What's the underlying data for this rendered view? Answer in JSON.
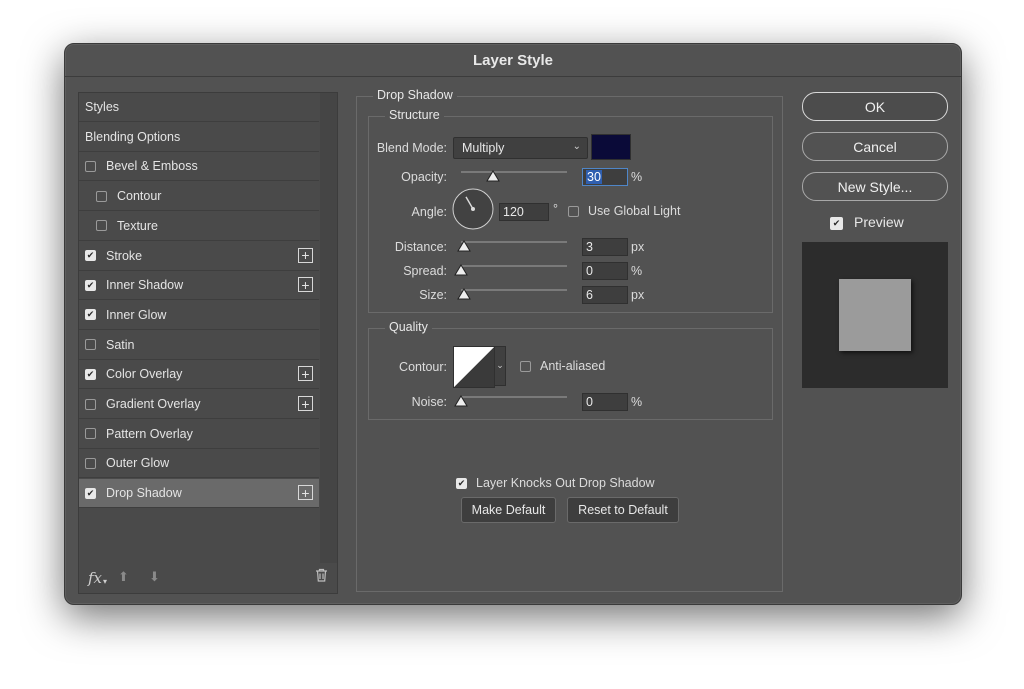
{
  "dialog": {
    "title": "Layer Style"
  },
  "style_list": {
    "items": [
      {
        "label": "Styles",
        "kind": "header"
      },
      {
        "label": "Blending Options",
        "kind": "header"
      },
      {
        "label": "Bevel & Emboss",
        "checked": false
      },
      {
        "label": "Contour",
        "checked": false,
        "indent": true
      },
      {
        "label": "Texture",
        "checked": false,
        "indent": true
      },
      {
        "label": "Stroke",
        "checked": true,
        "plus": true
      },
      {
        "label": "Inner Shadow",
        "checked": true,
        "plus": true
      },
      {
        "label": "Inner Glow",
        "checked": true
      },
      {
        "label": "Satin",
        "checked": false
      },
      {
        "label": "Color Overlay",
        "checked": true,
        "plus": true
      },
      {
        "label": "Gradient Overlay",
        "checked": false,
        "plus": true
      },
      {
        "label": "Pattern Overlay",
        "checked": false
      },
      {
        "label": "Outer Glow",
        "checked": false
      },
      {
        "label": "Drop Shadow",
        "checked": true,
        "plus": true,
        "selected": true
      }
    ],
    "footer": {
      "fx_label": "fx",
      "up_icon": "arrow-up-icon",
      "down_icon": "arrow-down-icon",
      "trash_icon": "trash-icon"
    }
  },
  "drop_shadow": {
    "title": "Drop Shadow",
    "structure": {
      "title": "Structure",
      "blend_mode_label": "Blend Mode:",
      "blend_mode_value": "Multiply",
      "color": "#0a0a38",
      "opacity_label": "Opacity:",
      "opacity_value": "30",
      "opacity_unit": "%",
      "angle_label": "Angle:",
      "angle_value": "120",
      "angle_unit": "°",
      "use_global_light_label": "Use Global Light",
      "use_global_light_checked": false,
      "distance_label": "Distance:",
      "distance_value": "3",
      "distance_unit": "px",
      "spread_label": "Spread:",
      "spread_value": "0",
      "spread_unit": "%",
      "size_label": "Size:",
      "size_value": "6",
      "size_unit": "px"
    },
    "quality": {
      "title": "Quality",
      "contour_label": "Contour:",
      "anti_aliased_label": "Anti-aliased",
      "anti_aliased_checked": false,
      "noise_label": "Noise:",
      "noise_value": "0",
      "noise_unit": "%"
    },
    "knockout_label": "Layer Knocks Out Drop Shadow",
    "knockout_checked": true,
    "make_default_label": "Make Default",
    "reset_default_label": "Reset to Default"
  },
  "actions": {
    "ok_label": "OK",
    "cancel_label": "Cancel",
    "new_style_label": "New Style...",
    "preview_label": "Preview",
    "preview_checked": true
  },
  "colors": {
    "dialog_bg": "#525252",
    "accent": "#2f5fb0",
    "preview_square": "#9b9b9b"
  }
}
